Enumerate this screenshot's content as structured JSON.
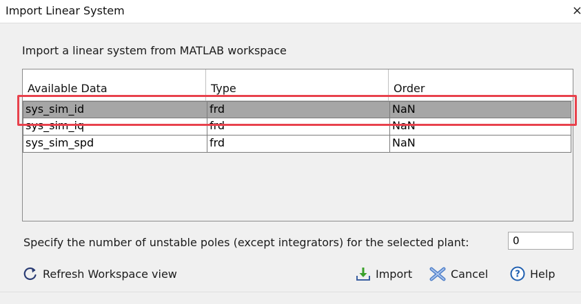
{
  "window": {
    "title": "Import Linear System",
    "close_glyph": "×"
  },
  "intro_text": "Import a linear system from MATLAB workspace",
  "table": {
    "columns": [
      "Available Data",
      "Type",
      "Order"
    ],
    "rows": [
      {
        "name": "sys_sim_id",
        "type": "frd",
        "order": "NaN",
        "selected": true
      },
      {
        "name": "sys_sim_iq",
        "type": "frd",
        "order": "NaN",
        "selected": false
      },
      {
        "name": "sys_sim_spd",
        "type": "frd",
        "order": "NaN",
        "selected": false
      }
    ]
  },
  "unstable_poles": {
    "label": "Specify the number of unstable poles (except integrators) for the selected plant:",
    "value": "0"
  },
  "buttons": {
    "refresh": "Refresh Workspace view",
    "import": "Import",
    "cancel": "Cancel",
    "help": "Help"
  },
  "colors": {
    "selection_row": "#a6a6a6",
    "annotation_outline": "#e8414c",
    "help_icon": "#1f5fb0",
    "import_arrow": "#3aa12a"
  }
}
